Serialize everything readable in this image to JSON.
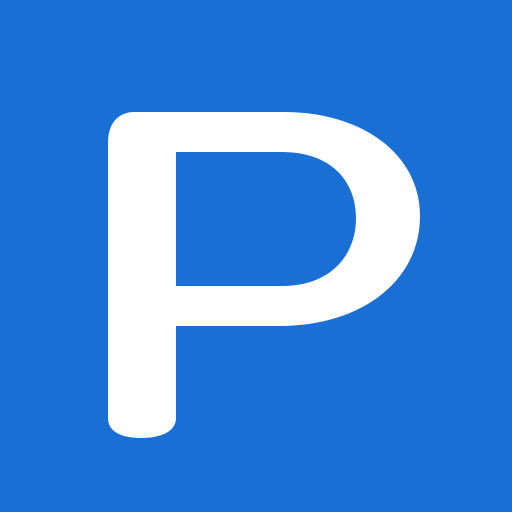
{
  "sign": {
    "letter": "P",
    "background_color": "#1a6fd4",
    "glyph_color": "#ffffff",
    "icon": "parking-icon"
  }
}
